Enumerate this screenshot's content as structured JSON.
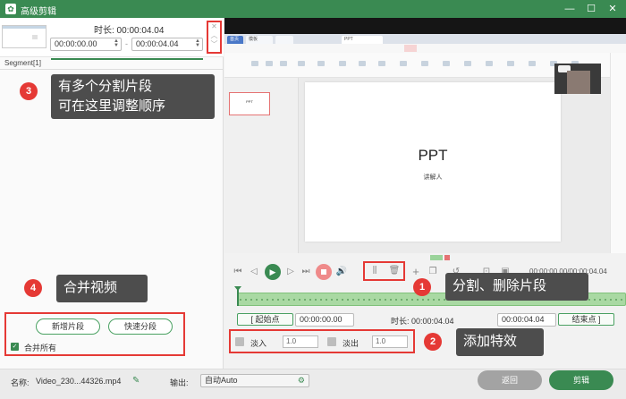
{
  "window": {
    "title": "高级剪辑",
    "buttons": {
      "minimize": "—",
      "maximize": "☐",
      "close": "✕"
    }
  },
  "segment": {
    "duration_label": "时长: 00:00:04.04",
    "start": "00:00:00.00",
    "end": "00:00:04.04",
    "separator": "-",
    "tab_label": "Segment[1]",
    "controls": [
      "✕",
      "︿",
      "﹀"
    ]
  },
  "callouts": {
    "c3": {
      "num": "3",
      "lines": [
        "有多个分割片段",
        "可在这里调整顺序"
      ]
    },
    "c4": {
      "num": "4",
      "text": "合并视频"
    },
    "c1": {
      "num": "1",
      "text": "分割、删除片段"
    },
    "c2": {
      "num": "2",
      "text": "添加特效"
    }
  },
  "left_buttons": {
    "add_segment": "新增片段",
    "quick_split": "快速分段",
    "merge_all": "合并所有"
  },
  "ppt": {
    "tab_active": "PPT",
    "tab_item_1": "首页",
    "tab_item_2": "模板",
    "slide_title": "PPT",
    "slide_subtitle": "讲解人",
    "thumb_title": "PPT"
  },
  "player": {
    "timecode": "00:00:00.00/00:00:04.04"
  },
  "trim": {
    "start_label": "起始点",
    "start_value": "00:00:00.00",
    "duration_label": "时长: 00:00:04.04",
    "end_value": "00:00:04.04",
    "end_label": "结束点"
  },
  "fade": {
    "fade_in_label": "淡入",
    "fade_in_value": "1.0",
    "fade_out_label": "淡出",
    "fade_out_value": "1.0"
  },
  "footer": {
    "name_label": "名称:",
    "name_value": "Video_230...44326.mp4",
    "output_label": "输出:",
    "output_value": "自动Auto",
    "back_button": "返回",
    "edit_button": "剪辑"
  },
  "colors": {
    "brand_green": "#3a8a52",
    "annotation_red": "#e53935",
    "callout_bg": "#4d4d4d"
  }
}
